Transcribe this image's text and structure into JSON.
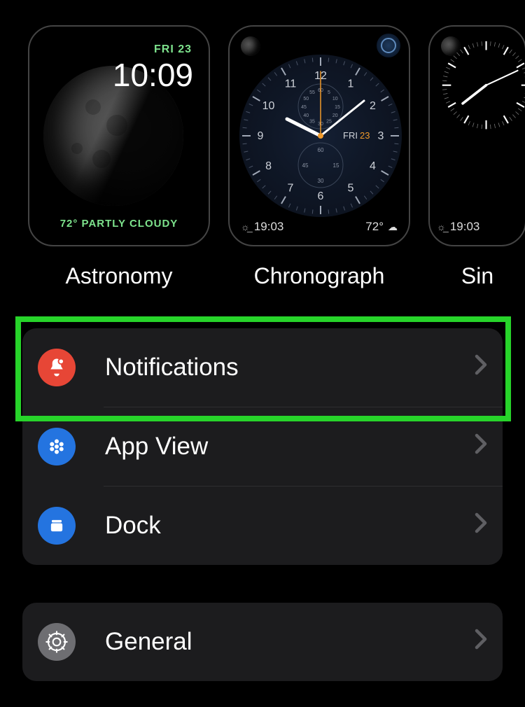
{
  "faces": {
    "astronomy": {
      "label": "Astronomy",
      "date": "FRI 23",
      "time": "10:09",
      "weather": "72° PARTLY CLOUDY"
    },
    "chronograph": {
      "label": "Chronograph",
      "day": "FRI",
      "daynum": "23",
      "sunset": "19:03",
      "temp": "72°",
      "hours": [
        "12",
        "1",
        "2",
        "3",
        "4",
        "5",
        "6",
        "7",
        "8",
        "9",
        "10",
        "11"
      ],
      "subdial_top": [
        "60",
        "5",
        "10",
        "15",
        "20",
        "25",
        "30",
        "35",
        "40",
        "45",
        "50",
        "55"
      ],
      "subdial_bot": [
        "60",
        "15",
        "30",
        "45"
      ]
    },
    "simple": {
      "label": "Sin",
      "sunset": "19:03"
    }
  },
  "group1": {
    "notifications": "Notifications",
    "appview": "App View",
    "dock": "Dock"
  },
  "group2": {
    "general": "General"
  }
}
